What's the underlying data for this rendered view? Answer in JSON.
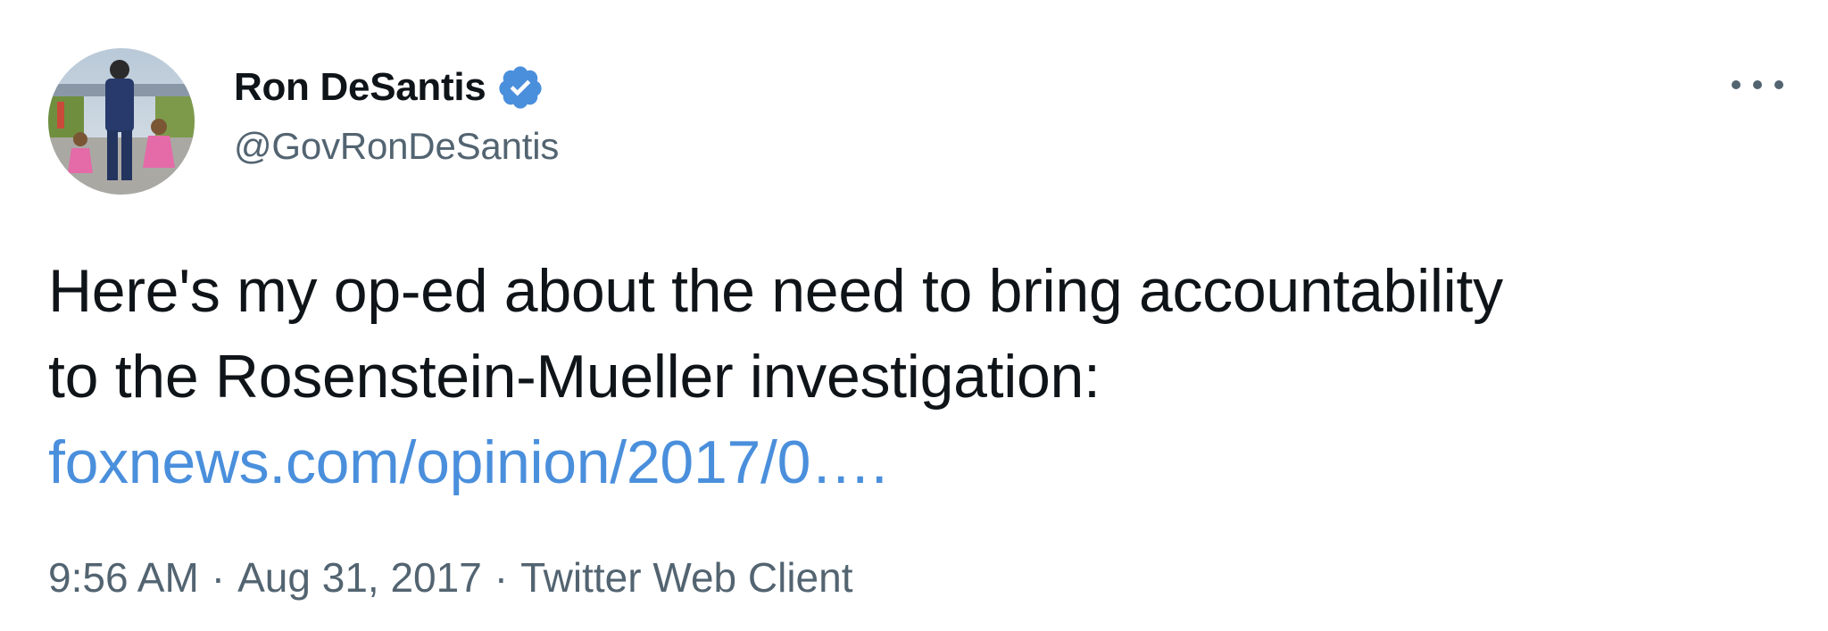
{
  "author": {
    "display_name": "Ron DeSantis",
    "handle": "@GovRonDeSantis",
    "verified": true,
    "avatar": "profile-photo"
  },
  "tweet": {
    "text_line_1": "Here's my op-ed about the need to bring accountability",
    "text_line_2": "to the Rosenstein-Mueller investigation:",
    "link_text": "foxnews.com/opinion/2017/0….",
    "time": "9:56 AM",
    "date": "Aug 31, 2017",
    "source": "Twitter Web Client",
    "separator": "·"
  },
  "icons": {
    "verified": "verified-badge-icon",
    "more": "more-options-icon"
  },
  "colors": {
    "text": "#0f1419",
    "secondary": "#536471",
    "link": "#4a8fdc",
    "verified": "#4a8fdc"
  }
}
